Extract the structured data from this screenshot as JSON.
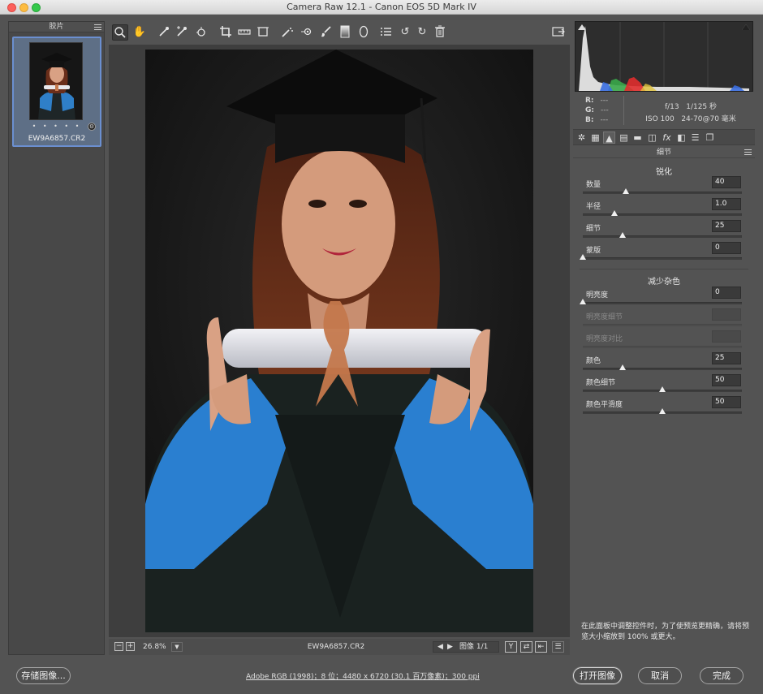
{
  "window": {
    "title": "Camera Raw 12.1 -  Canon EOS 5D Mark IV"
  },
  "filmstrip": {
    "header": "胶片",
    "file_name": "EW9A6857.CR2",
    "rating": "• • • • •"
  },
  "toolbar": {
    "tools": [
      "zoom-tool",
      "hand-tool",
      "white-balance-tool",
      "color-sampler-tool",
      "target-adjustment-tool",
      "crop-tool",
      "straighten-tool",
      "transform-tool",
      "spot-removal-tool",
      "red-eye-tool",
      "adjustment-brush-tool",
      "graduated-filter-tool",
      "radial-filter-tool",
      "preferences-tool",
      "rotate-left-tool",
      "rotate-right-tool",
      "trash-tool"
    ],
    "fullscreen_icon": "fullscreen-icon"
  },
  "readout": {
    "r_label": "R:",
    "g_label": "G:",
    "b_label": "B:",
    "r": "---",
    "g": "---",
    "b": "---",
    "aperture": "f/13",
    "shutter": "1/125 秒",
    "iso": "ISO 100",
    "lens": "24-70@70 毫米"
  },
  "panel": {
    "title": "细节",
    "sharpening": {
      "title": "锐化",
      "controls": [
        {
          "label": "数量",
          "value": "40",
          "position": 0.27,
          "enabled": true
        },
        {
          "label": "半径",
          "value": "1.0",
          "position": 0.2,
          "enabled": true
        },
        {
          "label": "细节",
          "value": "25",
          "position": 0.25,
          "enabled": true
        },
        {
          "label": "蒙版",
          "value": "0",
          "position": 0.0,
          "enabled": true
        }
      ]
    },
    "noise_reduction": {
      "title": "减少杂色",
      "controls": [
        {
          "label": "明亮度",
          "value": "0",
          "position": 0.0,
          "enabled": true
        },
        {
          "label": "明亮度细节",
          "value": "",
          "position": null,
          "enabled": false
        },
        {
          "label": "明亮度对比",
          "value": "",
          "position": null,
          "enabled": false
        },
        {
          "label": "颜色",
          "value": "25",
          "position": 0.25,
          "enabled": true
        },
        {
          "label": "颜色细节",
          "value": "50",
          "position": 0.5,
          "enabled": true
        },
        {
          "label": "颜色平滑度",
          "value": "50",
          "position": 0.5,
          "enabled": true
        }
      ]
    },
    "hint": "在此面板中调整控件时，为了使预览更精确，请将预览大小缩放到 100% 或更大。"
  },
  "status": {
    "zoom": "26.8%",
    "file_name": "EW9A6857.CR2",
    "image_counter": "图像 1/1",
    "minus": "−",
    "plus": "+",
    "prev": "◀",
    "next": "▶",
    "y_label": "Y"
  },
  "bottom": {
    "save_label": "存储图像...",
    "workflow": "Adobe RGB (1998)；8 位；4480 x 6720 (30.1 百万像素)；300 ppi",
    "open_label": "打开图像",
    "cancel_label": "取消",
    "done_label": "完成"
  }
}
